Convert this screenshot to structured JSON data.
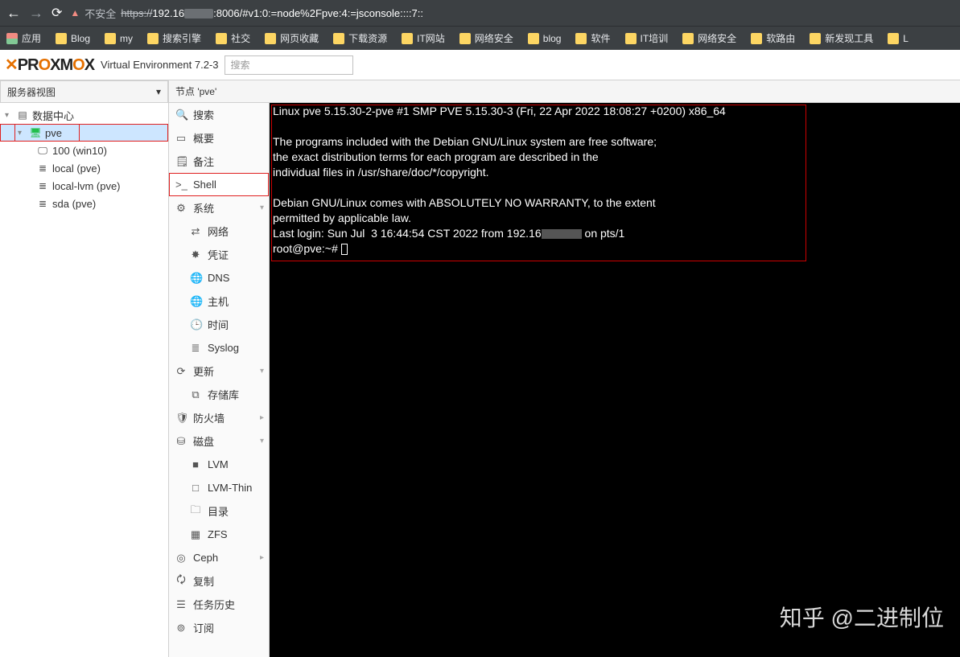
{
  "browser": {
    "warn_label": "不安全",
    "url_prefix": "https://",
    "url_host": "192.16",
    "url_port_path": ":8006/#v1:0:=node%2Fpve:4:=jsconsole::::7::"
  },
  "bookmarks": {
    "apps": "应用",
    "items": [
      "Blog",
      "my",
      "搜索引擎",
      "社交",
      "网页收藏",
      "下载资源",
      "IT网站",
      "网络安全",
      "blog",
      "软件",
      "IT培训",
      "网络安全",
      "软路由",
      "新发现工具",
      "L"
    ]
  },
  "header": {
    "brand_part1": "PR",
    "brand_part2": "XM",
    "brand_part3": "X",
    "version": "Virtual Environment 7.2-3",
    "search_placeholder": "搜索"
  },
  "left": {
    "view_label": "服务器视图",
    "datacenter": "数据中心",
    "node": "pve",
    "vm": "100 (win10)",
    "storages": [
      "local (pve)",
      "local-lvm (pve)",
      "sda (pve)"
    ]
  },
  "mid_header": "节点 'pve'",
  "nav": {
    "search": "搜索",
    "summary": "概要",
    "notes": "备注",
    "shell": "Shell",
    "system": "系统",
    "network": "网络",
    "certs": "凭证",
    "dns": "DNS",
    "hosts": "主机",
    "time": "时间",
    "syslog": "Syslog",
    "updates": "更新",
    "repo": "存储库",
    "firewall": "防火墙",
    "disks": "磁盘",
    "lvm": "LVM",
    "lvmthin": "LVM-Thin",
    "dir": "目录",
    "zfs": "ZFS",
    "ceph": "Ceph",
    "replication": "复制",
    "tasks": "任务历史",
    "subscription": "订阅"
  },
  "terminal": {
    "line1": "Linux pve 5.15.30-2-pve #1 SMP PVE 5.15.30-3 (Fri, 22 Apr 2022 18:08:27 +0200) x86_64",
    "line2": "",
    "line3": "The programs included with the Debian GNU/Linux system are free software;",
    "line4": "the exact distribution terms for each program are described in the",
    "line5": "individual files in /usr/share/doc/*/copyright.",
    "line6": "",
    "line7": "Debian GNU/Linux comes with ABSOLUTELY NO WARRANTY, to the extent",
    "line8": "permitted by applicable law.",
    "line9_a": "Last login: Sun Jul  3 16:44:54 CST 2022 from 192.16",
    "line9_b": " on pts/1",
    "prompt": "root@pve:~# "
  },
  "watermark": "知乎 @二进制位"
}
